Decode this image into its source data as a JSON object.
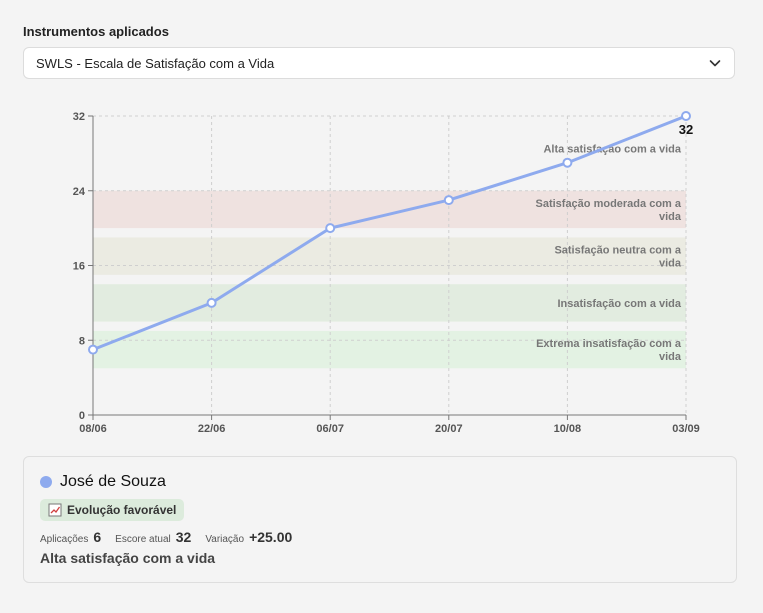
{
  "header": {
    "label": "Instrumentos aplicados"
  },
  "instrument_select": {
    "selected": "SWLS - Escala de Satisfação com a Vida"
  },
  "icons": {
    "select": "chevron-down-icon",
    "badge": "trend-chart-icon"
  },
  "chart_data": {
    "type": "line",
    "categories": [
      "08/06",
      "22/06",
      "06/07",
      "20/07",
      "10/08",
      "03/09"
    ],
    "series": [
      {
        "values": [
          7,
          12,
          20,
          23,
          27,
          32
        ],
        "color": "#8eaaee"
      }
    ],
    "ylim": [
      0,
      32
    ],
    "yticks": [
      0,
      8,
      16,
      24,
      32
    ],
    "grid": true,
    "last_point_label": "32",
    "bands": [
      {
        "from": 5,
        "to": 9,
        "label": "Extrema insatisfação com a vida",
        "color": "#e3f2e3"
      },
      {
        "from": 10,
        "to": 14,
        "label": "Insatisfação com a vida",
        "color": "#e2ece0"
      },
      {
        "from": 15,
        "to": 19,
        "label": "Satisfação neutra com a vida",
        "color": "#ebebe2"
      },
      {
        "from": 20,
        "to": 24,
        "label": "Satisfação moderada com a vida",
        "color": "#efe2e0"
      },
      {
        "from": 25,
        "to": 35,
        "label": "Alta satisfação com a vida",
        "color": "#f4f4f4"
      }
    ]
  },
  "card": {
    "name": "José de Souza",
    "dot_color": "#8eaaee",
    "badge_text": "Evolução favorável",
    "badge_bg": "#dcebdc",
    "stats": [
      {
        "label": "Aplicações",
        "value": "6"
      },
      {
        "label": "Escore atual",
        "value": "32"
      },
      {
        "label": "Variação",
        "value": "+25.00"
      }
    ],
    "status": "Alta satisfação com a vida"
  }
}
